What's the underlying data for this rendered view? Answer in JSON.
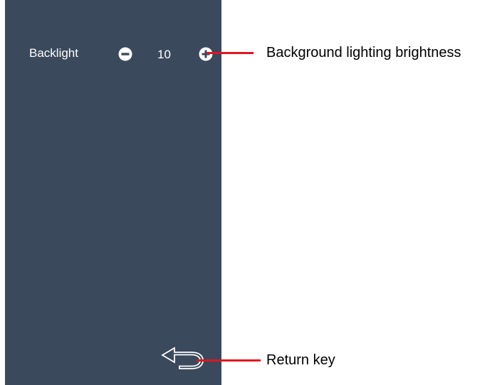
{
  "settings_panel": {
    "background_color": "#3a495c",
    "backlight": {
      "label": "Backlight",
      "value": "10",
      "decrease_icon": "minus-circle-icon",
      "increase_icon": "plus-circle-icon"
    },
    "return_key": {
      "icon": "return-arrow-icon"
    }
  },
  "annotations": {
    "callout_color": "#e0161e",
    "backlight_callout": "Background lighting brightness",
    "return_callout": "Return key"
  }
}
